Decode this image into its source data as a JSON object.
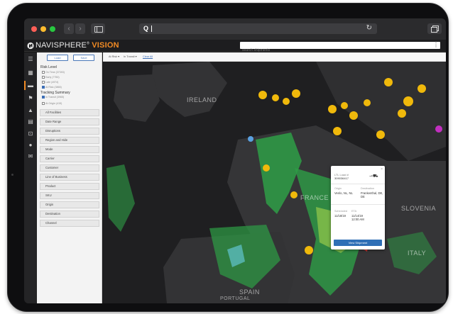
{
  "browser": {
    "back_icon": "chevron-left-icon",
    "forward_icon": "chevron-right-icon",
    "url_text": "",
    "search_icon": "search-icon",
    "reload_icon": "reload-icon"
  },
  "header": {
    "brand_main": "NAVISPHERE",
    "brand_reg": "®",
    "brand_accent": "VISION",
    "accent_color": "#f08a24",
    "search_placeholder": "search shipments"
  },
  "rail": {
    "icons": [
      "menu-icon",
      "dashboard-icon",
      "shipments-icon",
      "flag-icon",
      "alert-icon",
      "clipboard-icon",
      "cart-icon",
      "user-icon",
      "mail-icon"
    ]
  },
  "filters": {
    "load_label": "Load",
    "save_label": "Save",
    "risk_title": "Risk Level",
    "risk_items": [
      {
        "label": "On Time (37393)",
        "checked": false
      },
      {
        "label": "Early (7750)",
        "checked": false
      },
      {
        "label": "Late (4974)",
        "checked": false
      },
      {
        "label": "At Risk (3865)",
        "checked": true
      }
    ],
    "tracking_title": "Tracking Summary",
    "tracking_items": [
      {
        "label": "In Transit (3965)",
        "checked": true
      },
      {
        "label": "At Origin (415)",
        "checked": false
      }
    ],
    "facets": [
      "All Facilities",
      "Date Range",
      "Disruptions",
      "Region and Hide",
      "Mode",
      "Carrier",
      "Customer",
      "Line of Business",
      "Product",
      "SKU",
      "Origin",
      "Destination",
      "Channel"
    ]
  },
  "chips": {
    "chip1": "At Risk",
    "chip2": "In Transit",
    "clear_all": "Clear All"
  },
  "map": {
    "labels": {
      "ireland": "IRELAND",
      "france": "FRANCE",
      "slovenia": "SLOVENIA",
      "italy": "ITALY",
      "spain": "SPAIN",
      "portugal": "PORTUGAL"
    }
  },
  "popup": {
    "title": "LTL Load #",
    "load_id": "309036417",
    "origin_label": "Origin",
    "origin_value": "Venlo, NL, NL",
    "destination_label": "Destination",
    "destination_value": "Frankenthal, DE, DE",
    "scheduled_label": "Scheduled",
    "scheduled_value": "11/18/19",
    "eta_label": "ETA",
    "eta_value": "11/14/19 12:00 AM",
    "button_label": "View Shipment"
  }
}
